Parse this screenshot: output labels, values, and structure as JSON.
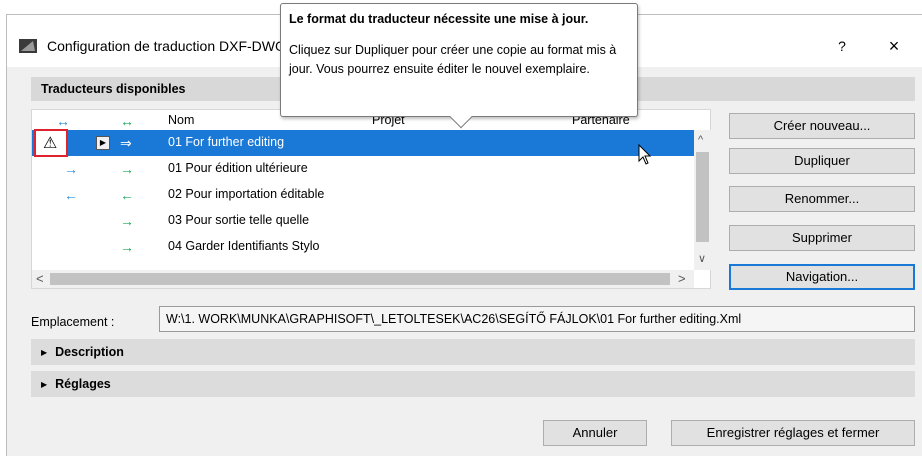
{
  "window": {
    "title": "Configuration de traduction DXF-DWG",
    "help_label": "?",
    "close_label": "×"
  },
  "tooltip": {
    "title": "Le format du traducteur nécessite une mise à jour.",
    "body": "Cliquez sur Dupliquer pour créer une copie au format mis à jour. Vous pourrez ensuite éditer le nouvel exemplaire."
  },
  "translators": {
    "section_title": "Traducteurs disponibles",
    "columns": {
      "col1_icon": "↔",
      "col2_icon": "↔",
      "name": "Nom",
      "project": "Projet",
      "partner": "Partenaire"
    },
    "rows": [
      {
        "name": "01 For further editing",
        "arrow1": "",
        "arrow2": "⇒",
        "warning": "⚠",
        "play": "▶",
        "selected": true
      },
      {
        "name": "01 Pour édition ultérieure",
        "arrow1": "→",
        "arrow2": "→"
      },
      {
        "name": "02 Pour importation éditable",
        "arrow1": "←",
        "arrow2": "←"
      },
      {
        "name": "03 Pour sortie telle quelle",
        "arrow1": "",
        "arrow2": "→"
      },
      {
        "name": "04 Garder Identifiants Stylo",
        "arrow1": "",
        "arrow2": "→"
      }
    ]
  },
  "buttons": {
    "create_new": "Créer nouveau...",
    "duplicate": "Dupliquer",
    "rename": "Renommer...",
    "delete": "Supprimer",
    "navigation": "Navigation..."
  },
  "location": {
    "label": "Emplacement :",
    "value": "W:\\1. WORK\\MUNKA\\GRAPHISOFT\\_LETOLTESEK\\AC26\\SEGÍTŐ FÁJLOK\\01 For further editing.Xml"
  },
  "sections": {
    "description": "Description",
    "settings": "Réglages"
  },
  "footer": {
    "cancel": "Annuler",
    "save_close": "Enregistrer réglages et fermer"
  },
  "colors": {
    "selection": "#1a78d6",
    "warning_outline": "#e0222c",
    "arrow_blue": "#2e8fd6",
    "arrow_green": "#1ea85a"
  }
}
